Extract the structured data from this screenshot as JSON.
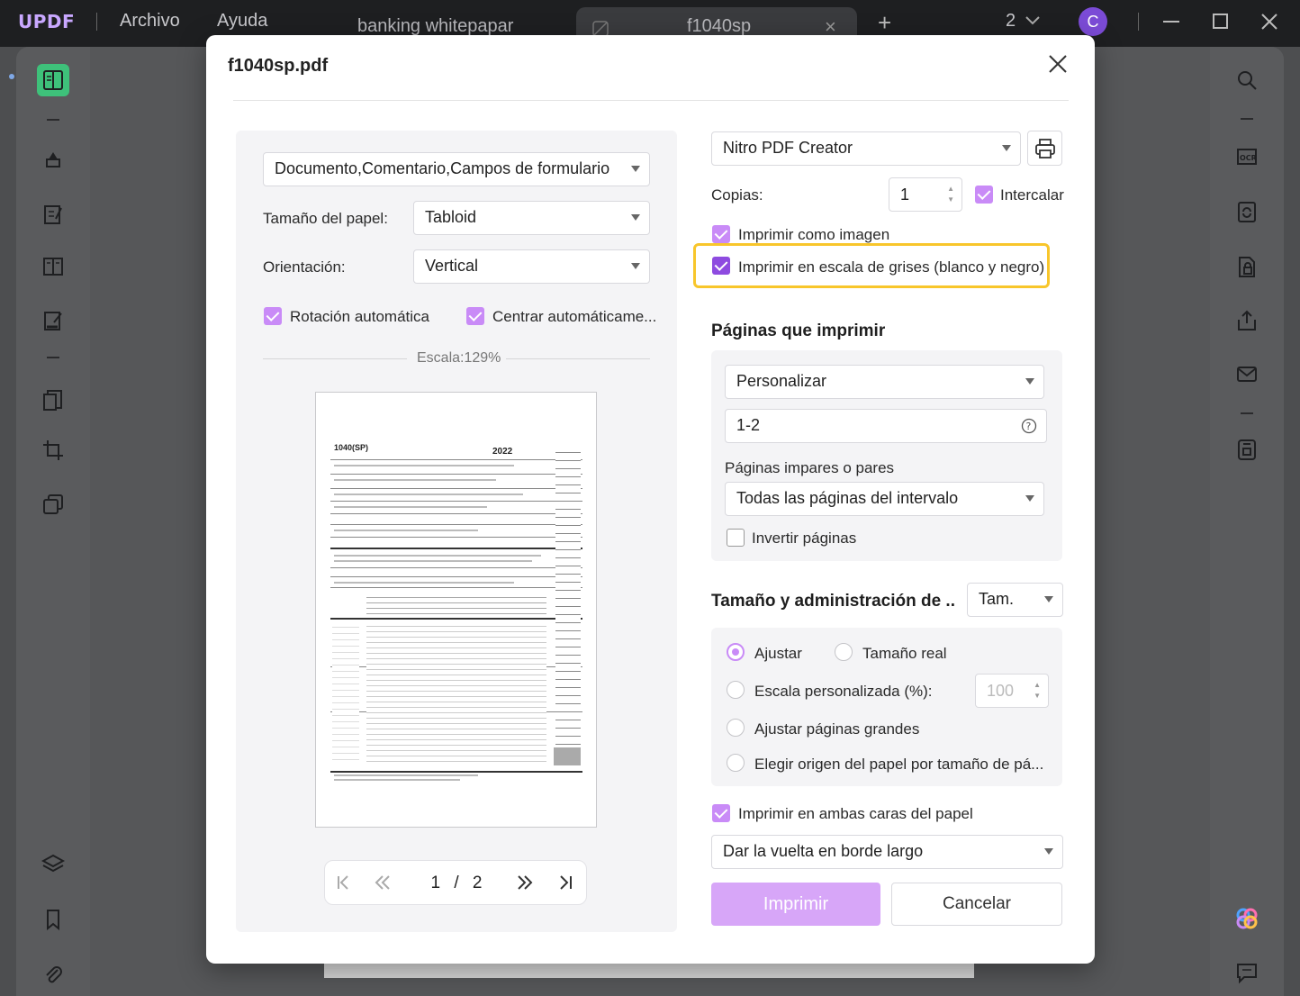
{
  "app": {
    "logo": "UPDF",
    "menu": [
      "Archivo",
      "Ayuda"
    ],
    "tabs": [
      {
        "label": "banking whitepapar"
      },
      {
        "label": "f1040sp"
      }
    ],
    "page_count_badge": "2",
    "avatar_initial": "C"
  },
  "dialog": {
    "title": "f1040sp.pdf",
    "content_select": "Documento,Comentario,Campos de formulario",
    "paper_size_label": "Tamaño del papel:",
    "paper_size": "Tabloid",
    "orientation_label": "Orientación:",
    "orientation": "Vertical",
    "auto_rotate": {
      "label": "Rotación automática",
      "checked": true
    },
    "auto_center": {
      "label": "Centrar automáticame...",
      "checked": true
    },
    "scale_label": "Escala:129%",
    "pager": {
      "current": "1",
      "separator": "/",
      "total": "2"
    },
    "printer": "Nitro PDF Creator",
    "copies_label": "Copias:",
    "copies": "1",
    "collate": {
      "label": "Intercalar",
      "checked": true
    },
    "print_as_image": {
      "label": "Imprimir como imagen",
      "checked": true
    },
    "grayscale": {
      "label": "Imprimir en escala de grises (blanco y negro)",
      "checked": true
    },
    "pages_section": {
      "title": "Páginas que imprimir",
      "mode": "Personalizar",
      "range": "1-2",
      "odd_even_label": "Páginas impares o pares",
      "odd_even": "Todas las páginas del intervalo",
      "reverse": {
        "label": "Invertir páginas",
        "checked": false
      }
    },
    "size_section": {
      "title": "Tamaño y administración de ..",
      "mode": "Tam.",
      "fit": {
        "label": "Ajustar",
        "selected": true
      },
      "actual": {
        "label": "Tamaño real",
        "selected": false
      },
      "custom_scale": {
        "label": "Escala personalizada (%):",
        "value": "100",
        "selected": false
      },
      "shrink_large": {
        "label": "Ajustar páginas grandes",
        "selected": false
      },
      "paper_source": {
        "label": "Elegir origen del papel por tamaño de pá...",
        "selected": false
      }
    },
    "duplex": {
      "label": "Imprimir en ambas caras del papel",
      "checked": true
    },
    "duplex_mode": "Dar la vuelta en borde largo",
    "print_button": "Imprimir",
    "cancel_button": "Cancelar"
  },
  "preview_form": {
    "form_number": "1040(SP)",
    "year": "2022"
  },
  "colors": {
    "accent": "#c98bf7",
    "highlight": "#f8c62b",
    "primary_button": "#d7a6f8"
  }
}
